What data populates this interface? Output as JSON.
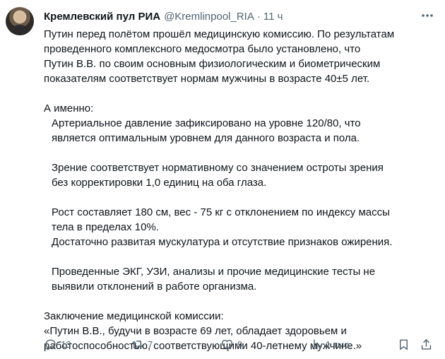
{
  "author": {
    "display_name": "Кремлевский пул РИА",
    "handle": "@Kremlinpool_RIA",
    "separator": "·",
    "time": "11 ч"
  },
  "menu_icon": "more-horizontal-icon",
  "post": {
    "intro": [
      "Путин перед полётом прошёл медицинскую комиссию. По результатам",
      "проведенного комплексного медосмотра было установлено, что",
      "Путин В.В. по своим основным физиологическим и биометрическим",
      "показателям соответствует нормам мужчины в возрасте 40±5 лет."
    ],
    "list_heading": "А именно:",
    "pressure": [
      "Артериальное давление зафиксировано на уровне 120/80, что",
      "является оптимальным уровнем для данного возраста и пола."
    ],
    "vision": [
      "Зрение соответствует нормативному со значением остроты зрения",
      "без корректировки 1,0 единиц на оба глаза."
    ],
    "height_weight": [
      "Рост составляет 180 см, вес - 75 кг с отклонением по индексу массы",
      "тела в пределах 10%.",
      "Достаточно развитая мускулатура и отсутствие признаков ожирения."
    ],
    "tests": [
      "Проведенные ЭКГ, УЗИ, анализы и прочие медицинские тесты не",
      "выявили отклонений в работе организма."
    ],
    "conclusion": [
      "Заключение медицинской комиссии:",
      "«Путин В.В., будучи в возрасте 69 лет, обладает здоровьем и",
      "работоспособностью, соответствующими 40-летнему мужчине.»"
    ]
  },
  "actions": {
    "replies": "13",
    "reposts": "7",
    "likes": "9",
    "views": "1 тыс.",
    "icons": [
      "reply-icon",
      "repost-icon",
      "like-icon",
      "views-icon",
      "bookmark-icon",
      "share-icon"
    ]
  },
  "colors": {
    "text": "#0f1419",
    "secondary": "#536471",
    "background": "#ffffff"
  }
}
